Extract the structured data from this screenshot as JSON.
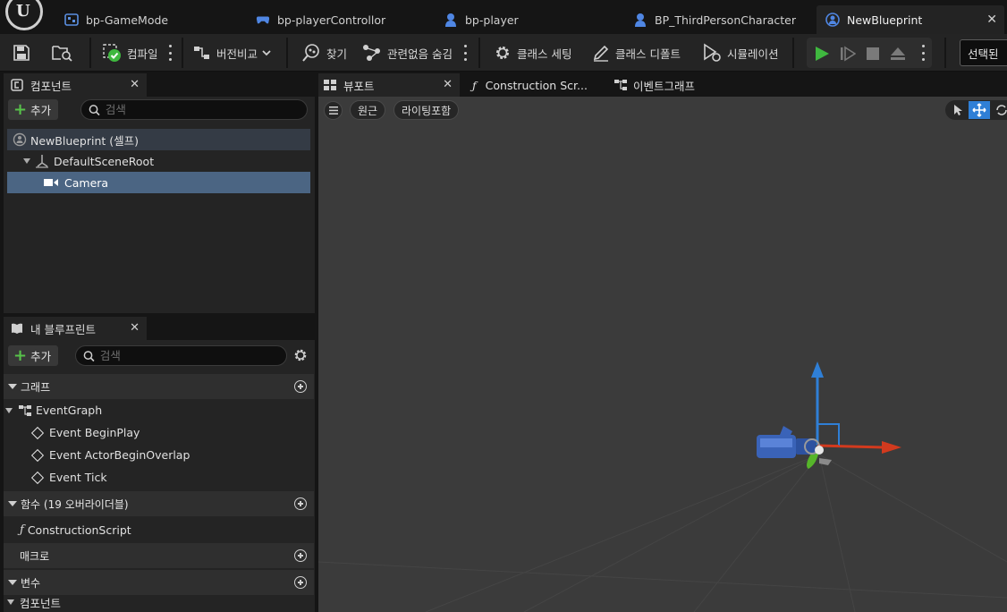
{
  "doc_tabs": [
    {
      "label": "bp-GameMode",
      "icon": "gamemode-icon"
    },
    {
      "label": "bp-playerControllor",
      "icon": "gamepad-icon"
    },
    {
      "label": "bp-player",
      "icon": "pawn-icon"
    },
    {
      "label": "BP_ThirdPersonCharacter",
      "icon": "pawn-icon"
    },
    {
      "label": "NewBlueprint",
      "icon": "blueprint-actor-icon",
      "active": true
    }
  ],
  "toolbar": {
    "compile": "컴파일",
    "diff": "버전비교",
    "find": "찾기",
    "hide_unrelated": "관련없음 숨김",
    "class_settings": "클래스 세팅",
    "class_defaults": "클래스 디폴트",
    "simulation": "시뮬레이션",
    "selected": "선택된 "
  },
  "components_panel": {
    "title": "컴포넌트",
    "add_label": "추가",
    "search_placeholder": "검색",
    "items": [
      {
        "label": "NewBlueprint (셀프)"
      },
      {
        "label": "DefaultSceneRoot"
      },
      {
        "label": "Camera"
      }
    ]
  },
  "mybp_panel": {
    "title": "내 블루프린트",
    "add_label": "추가",
    "search_placeholder": "검색",
    "sections": {
      "graphs": "그래프",
      "functions": "함수 (19 오버라이더블)",
      "macros": "매크로",
      "variables": "변수",
      "components": "컴포넌트"
    },
    "event_graph": "EventGraph",
    "events": [
      "Event BeginPlay",
      "Event ActorBeginOverlap",
      "Event Tick"
    ],
    "functions": [
      "ConstructionScript"
    ]
  },
  "editor_tabs": [
    {
      "label": "뷰포트",
      "active": true
    },
    {
      "label": "Construction Scr..."
    },
    {
      "label": "이벤트그래프"
    }
  ],
  "viewport": {
    "perspective": "원근",
    "lighting": "라이팅포함"
  },
  "colors": {
    "accent_blue": "#2f7fd6",
    "play_green": "#3fb83f",
    "axis_red": "#d23a1e",
    "axis_green": "#56b52a",
    "selection": "#4b6583"
  }
}
